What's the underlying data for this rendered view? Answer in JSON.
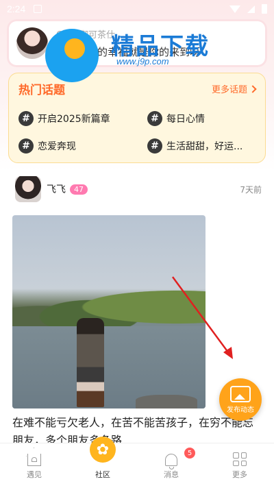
{
  "status_bar": {
    "time": "2:24"
  },
  "notice": {
    "user": "CoCo御可茶仕",
    "message": "哥哥，我的幸福就是你的来到呀"
  },
  "watermark": {
    "title": "精品下载",
    "url": "www.j9p.com"
  },
  "hot_topics": {
    "title": "热门话题",
    "more_label": "更多话题",
    "items": [
      {
        "label": "开启2025新篇章"
      },
      {
        "label": "每日心情"
      },
      {
        "label": "恋爱奔现"
      },
      {
        "label": "生活甜甜，好运..."
      }
    ]
  },
  "post": {
    "author": "飞飞",
    "level": "47",
    "time": "7天前",
    "text": "在难不能亏欠老人，在苦不能苦孩子，在穷不能忘朋友，多个朋友多条路"
  },
  "fab": {
    "label": "发布动态"
  },
  "bottom_nav": {
    "items": [
      {
        "label": "遇见"
      },
      {
        "label": "社区"
      },
      {
        "label": "消息"
      },
      {
        "label": "更多"
      }
    ],
    "message_badge": "5"
  },
  "colors": {
    "accent_orange": "#ff6a2a",
    "fab_orange": "#ffa31a",
    "level_pink": "#ff7ab0",
    "badge_red": "#ff5a5a"
  }
}
